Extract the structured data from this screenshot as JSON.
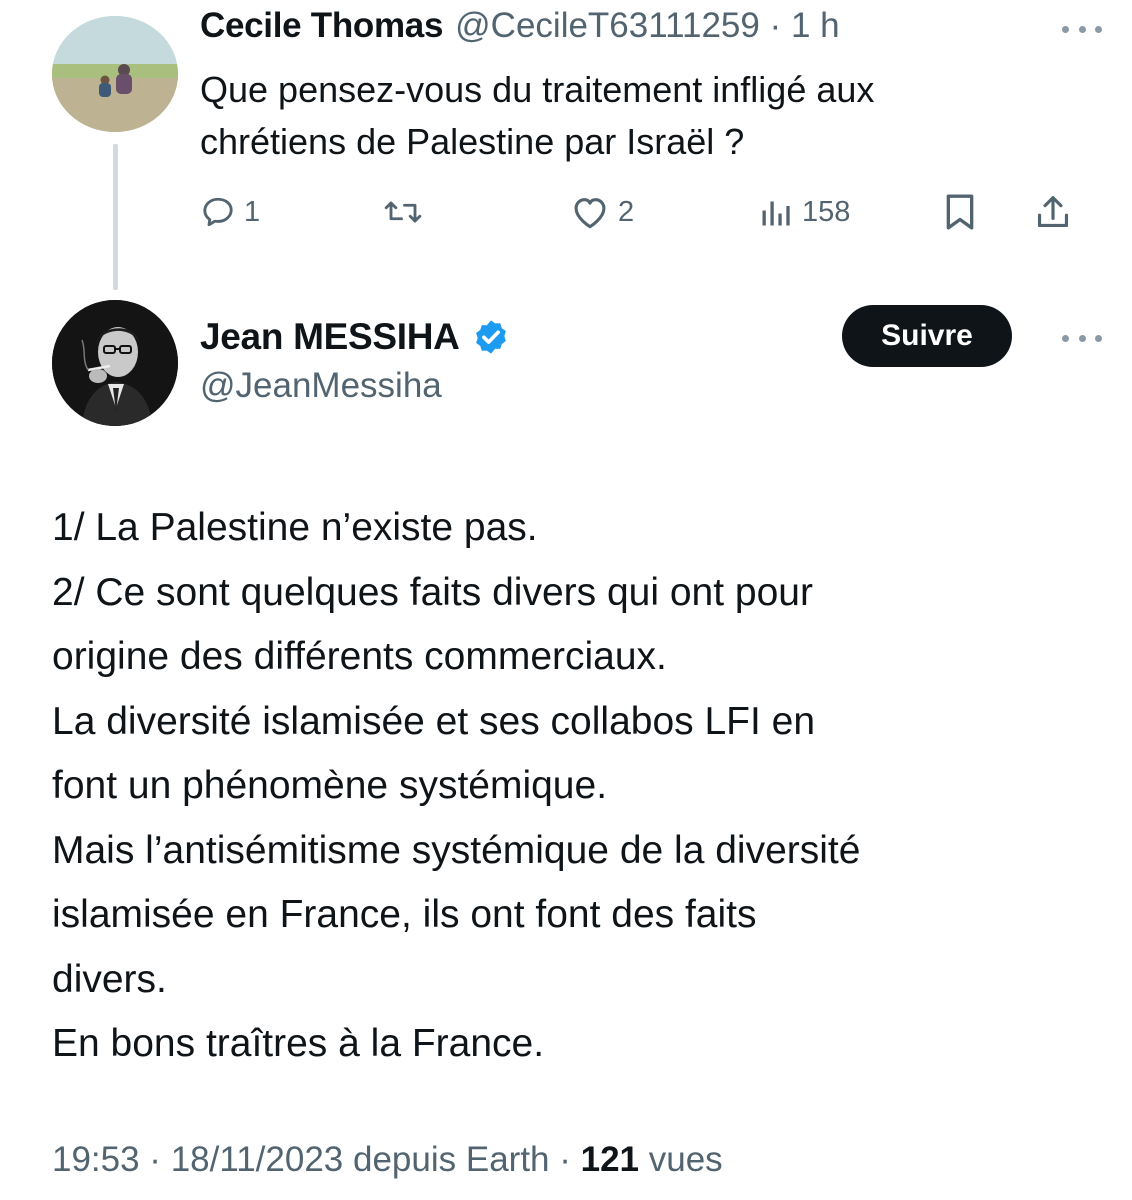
{
  "parent_tweet": {
    "author_name": "Cecile Thomas",
    "meta": "@CecileT63111259 · 1 h",
    "text_lines": [
      "Que pensez-vous du traitement infligé aux",
      "chrétiens de Palestine par Israël ?"
    ],
    "actions": {
      "replies": "1",
      "retweets": "",
      "likes": "2",
      "views": "158"
    }
  },
  "main_tweet": {
    "author_name": "Jean MESSIHA",
    "handle": "@JeanMessiha",
    "follow_label": "Suivre",
    "body_lines": [
      "1/ La Palestine n’existe pas.",
      "2/ Ce sont quelques faits divers qui ont pour",
      "origine des différents commerciaux.",
      "La diversité islamisée et ses collabos LFI en",
      "font un phénomène systémique.",
      "Mais l’antisémitisme systémique de la diversité",
      "islamisée en France, ils ont font des faits",
      "divers.",
      "En bons traîtres à la France."
    ],
    "timestamp": "19:53 · 18/11/2023 depuis Earth · ",
    "views_count": "121",
    "views_label": " vues"
  },
  "icons": {
    "reply": "reply-icon",
    "retweet": "retweet-icon",
    "like": "heart-icon",
    "views": "views-chart-icon",
    "bookmark": "bookmark-icon",
    "share": "share-icon",
    "more": "more-dots-icon",
    "verified": "verified-badge-icon"
  },
  "colors": {
    "text_primary": "#0f1419",
    "text_secondary": "#536471",
    "verified_blue": "#1d9bf0",
    "follow_button_bg": "#0f1419",
    "thread_line": "#cfd9de"
  }
}
